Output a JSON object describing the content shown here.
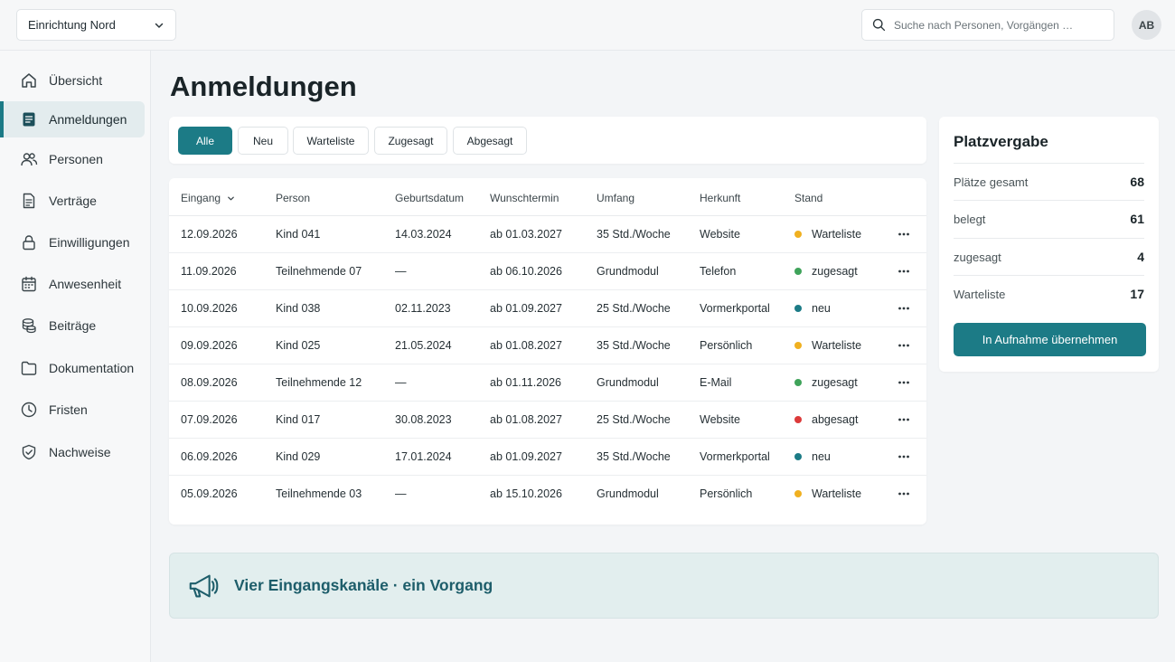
{
  "header": {
    "facility": "Einrichtung Nord",
    "search_placeholder": "Suche nach Personen, Vorgängen …",
    "avatar_initials": "AB"
  },
  "sidebar": {
    "items": [
      {
        "label": "Übersicht",
        "icon": "home-icon",
        "active": false
      },
      {
        "label": "Anmeldungen",
        "icon": "document-icon",
        "active": true
      },
      {
        "label": "Personen",
        "icon": "people-icon",
        "active": false
      },
      {
        "label": "Verträge",
        "icon": "contract-icon",
        "active": false
      },
      {
        "label": "Einwilligungen",
        "icon": "lock-icon",
        "active": false
      },
      {
        "label": "Anwesenheit",
        "icon": "calendar-icon",
        "active": false
      },
      {
        "label": "Beiträge",
        "icon": "coins-icon",
        "active": false
      },
      {
        "label": "Dokumentation",
        "icon": "folder-icon",
        "active": false
      },
      {
        "label": "Fristen",
        "icon": "clock-icon",
        "active": false
      },
      {
        "label": "Nachweise",
        "icon": "shield-check-icon",
        "active": false
      }
    ]
  },
  "main": {
    "title": "Anmeldungen",
    "filters": [
      "Alle",
      "Neu",
      "Warteliste",
      "Zugesagt",
      "Abgesagt"
    ],
    "active_filter": "Alle",
    "table": {
      "columns": [
        "Eingang",
        "Person",
        "Geburtsdatum",
        "Wunschtermin",
        "Umfang",
        "Herkunft",
        "Stand"
      ],
      "sorted_column": "Eingang",
      "rows": [
        {
          "eingang": "12.09.2026",
          "person": "Kind 041",
          "geburtsdatum": "14.03.2024",
          "wunschtermin": "ab 01.03.2027",
          "umfang": "35 Std./Woche",
          "herkunft": "Website",
          "stand": "Warteliste"
        },
        {
          "eingang": "11.09.2026",
          "person": "Teilnehmende 07",
          "geburtsdatum": "—",
          "wunschtermin": "ab 06.10.2026",
          "umfang": "Grundmodul",
          "herkunft": "Telefon",
          "stand": "zugesagt"
        },
        {
          "eingang": "10.09.2026",
          "person": "Kind 038",
          "geburtsdatum": "02.11.2023",
          "wunschtermin": "ab 01.09.2027",
          "umfang": "25 Std./Woche",
          "herkunft": "Vormerkportal",
          "stand": "neu"
        },
        {
          "eingang": "09.09.2026",
          "person": "Kind 025",
          "geburtsdatum": "21.05.2024",
          "wunschtermin": "ab 01.08.2027",
          "umfang": "35 Std./Woche",
          "herkunft": "Persönlich",
          "stand": "Warteliste"
        },
        {
          "eingang": "08.09.2026",
          "person": "Teilnehmende 12",
          "geburtsdatum": "—",
          "wunschtermin": "ab 01.11.2026",
          "umfang": "Grundmodul",
          "herkunft": "E-Mail",
          "stand": "zugesagt"
        },
        {
          "eingang": "07.09.2026",
          "person": "Kind 017",
          "geburtsdatum": "30.08.2023",
          "wunschtermin": "ab 01.08.2027",
          "umfang": "25 Std./Woche",
          "herkunft": "Website",
          "stand": "abgesagt"
        },
        {
          "eingang": "06.09.2026",
          "person": "Kind 029",
          "geburtsdatum": "17.01.2024",
          "wunschtermin": "ab 01.09.2027",
          "umfang": "35 Std./Woche",
          "herkunft": "Vormerkportal",
          "stand": "neu"
        },
        {
          "eingang": "05.09.2026",
          "person": "Teilnehmende 03",
          "geburtsdatum": "—",
          "wunschtermin": "ab 15.10.2026",
          "umfang": "Grundmodul",
          "herkunft": "Persönlich",
          "stand": "Warteliste"
        }
      ]
    }
  },
  "status_colors": {
    "Warteliste": "#f0b020",
    "zugesagt": "#3fa35a",
    "neu": "#1c7b86",
    "abgesagt": "#dc3a3a"
  },
  "placement": {
    "title": "Platzvergabe",
    "stats": [
      {
        "label": "Plätze gesamt",
        "value": "68"
      },
      {
        "label": "belegt",
        "value": "61"
      },
      {
        "label": "zugesagt",
        "value": "4"
      },
      {
        "label": "Warteliste",
        "value": "17"
      }
    ],
    "button_label": "In Aufnahme übernehmen"
  },
  "banner": {
    "icon": "megaphone-icon",
    "text": "Vier Eingangskanäle · ein Vorgang"
  },
  "colors": {
    "accent": "#1c7b86",
    "banner_text": "#1d5d6a"
  }
}
